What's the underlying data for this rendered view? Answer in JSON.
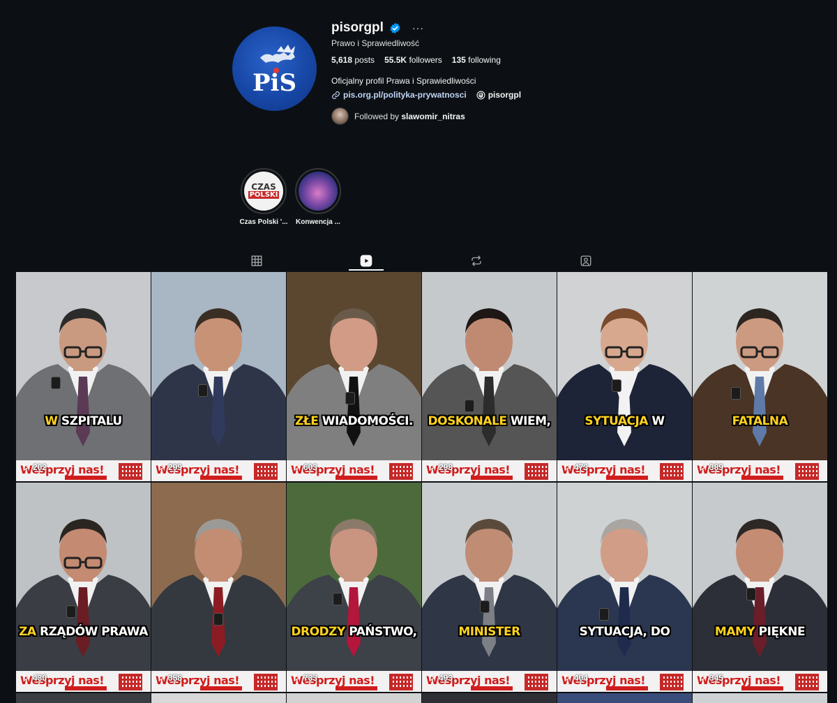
{
  "profile": {
    "username": "pisorgpl",
    "full_name": "Prawo i Sprawiedliwość",
    "posts_count": "5,618",
    "posts_label": "posts",
    "followers_count": "55.5K",
    "followers_label": "followers",
    "following_count": "135",
    "following_label": "following",
    "bio": "Oficjalny profil Prawa i Sprawiedliwości",
    "link": "pis.org.pl/polityka-prywatnosci",
    "threads_handle": "pisorgpl",
    "followed_by_prefix": "Followed by",
    "followed_by_user": "slawomir_nitras",
    "more_label": "···",
    "logo_text": "PiS"
  },
  "highlights": [
    {
      "label": "Czas Polski '...",
      "art_line1": "CZAS",
      "art_line2": "POLSKI"
    },
    {
      "label": "Konwencja ..."
    }
  ],
  "tabs": [
    "posts-grid",
    "reels",
    "reposts",
    "tagged"
  ],
  "active_tab": "reels",
  "banner_text": "Wesprzyj nas!",
  "reels": [
    {
      "views": "202",
      "caption_hl": "W",
      "caption_rest": " SZPITALU",
      "bg": "#c7c9cc",
      "suit": "#6f7073",
      "tie": "#5a3a55",
      "skin": "#c99a80",
      "glasses": true,
      "hair": "#2b2b2b"
    },
    {
      "views": "299",
      "caption_hl": "",
      "caption_rest": "",
      "bg": "#a9b6c4",
      "suit": "#2e3548",
      "tie": "#303a5c",
      "skin": "#c79276",
      "glasses": false,
      "hair": "#3a2d24"
    },
    {
      "views": "603",
      "caption_hl": "ZŁE",
      "caption_rest": " WIADOMOŚCI.",
      "bg": "#5b4630",
      "suit": "#7f7f7f",
      "tie": "#111111",
      "skin": "#d19b85",
      "glasses": false,
      "hair": "#6a5a4a"
    },
    {
      "views": "298",
      "caption_hl": "DOSKONALE",
      "caption_rest": " WIEM,",
      "bg": "#c6c9cc",
      "suit": "#555555",
      "tie": "#2c2c2c",
      "skin": "#c08a72",
      "glasses": false,
      "hair": "#1e1715"
    },
    {
      "views": "473",
      "caption_hl": "SYTUACJA",
      "caption_rest": " W",
      "bg": "#d0d2d4",
      "suit": "#1d2438",
      "tie": "#f2f2f2",
      "skin": "#d8a88e",
      "glasses": true,
      "hair": "#7a4a2c"
    },
    {
      "views": "389",
      "caption_hl": "",
      "caption_rest": "",
      "caption_hl2": "FATALNA",
      "bg": "#cfd3d4",
      "suit": "#4a3426",
      "tie": "#5f7aa8",
      "skin": "#cc9a80",
      "glasses": true,
      "hair": "#2d2520"
    },
    {
      "views": "430",
      "caption_hl": "ZA",
      "caption_rest": " RZĄDÓW PRAWA",
      "bg": "#bfc2c4",
      "suit": "#3a3d44",
      "tie": "#6b1d24",
      "skin": "#c48a72",
      "glasses": true,
      "hair": "#2a2520"
    },
    {
      "views": "358",
      "caption_hl": "",
      "caption_rest": "",
      "bg": "#8d6b4f",
      "suit": "#34383f",
      "tie": "#8c1c24",
      "skin": "#c38d73",
      "glasses": false,
      "hair": "#9c9a96"
    },
    {
      "views": "733",
      "caption_hl": "DRODZY",
      "caption_rest": " PAŃSTWO,",
      "bg": "#4d6a3c",
      "suit": "#3d4148",
      "tie": "#b3173b",
      "skin": "#c99580",
      "glasses": false,
      "hair": "#8b7a6a"
    },
    {
      "views": "493",
      "caption_hl": "MINISTER",
      "caption_rest": "",
      "bg": "#c9ccce",
      "suit": "#2f3646",
      "tie": "#7c8086",
      "skin": "#c08c74",
      "glasses": false,
      "hair": "#5a4a3c"
    },
    {
      "views": "404",
      "caption_hl": "",
      "caption_rest": "SYTUACJA, DO",
      "bg": "#cfd2d3",
      "suit": "#2b3650",
      "tie": "#1f2b4d",
      "skin": "#d19d86",
      "glasses": false,
      "hair": "#a9a6a2"
    },
    {
      "views": "345",
      "caption_hl": "MAMY",
      "caption_rest": " PIĘKNE",
      "bg": "#c7cacc",
      "suit": "#2c2f37",
      "tie": "#6b1d2a",
      "skin": "#c58c74",
      "glasses": false,
      "hair": "#2d2826"
    }
  ],
  "partial_row": [
    "#3a3d42",
    "#d8d8d8",
    "#d2d2d2",
    "#2d2f34",
    "#3a4c7a",
    "#cfd2d4"
  ]
}
